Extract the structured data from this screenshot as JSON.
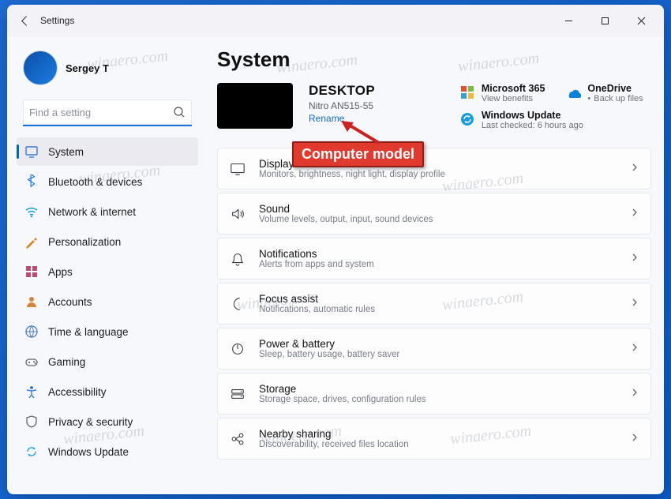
{
  "app": {
    "title": "Settings"
  },
  "user": {
    "name": "Sergey T"
  },
  "search": {
    "placeholder": "Find a setting"
  },
  "nav": {
    "items": [
      {
        "id": "system",
        "icon": "monitor",
        "label": "System",
        "active": true,
        "color": "#3a7bd5"
      },
      {
        "id": "bluetooth",
        "icon": "bluetooth",
        "label": "Bluetooth & devices",
        "color": "#1a73d9"
      },
      {
        "id": "network",
        "icon": "wifi",
        "label": "Network & internet",
        "color": "#18a0d8"
      },
      {
        "id": "personalization",
        "icon": "brush",
        "label": "Personalization",
        "color": "#d88a2a"
      },
      {
        "id": "apps",
        "icon": "grid",
        "label": "Apps",
        "color": "#c24a6e"
      },
      {
        "id": "accounts",
        "icon": "person",
        "label": "Accounts",
        "color": "#d8843a"
      },
      {
        "id": "time",
        "icon": "globe",
        "label": "Time & language",
        "color": "#4a7ac2"
      },
      {
        "id": "gaming",
        "icon": "gamepad",
        "label": "Gaming",
        "color": "#666"
      },
      {
        "id": "accessibility",
        "icon": "accessibility",
        "label": "Accessibility",
        "color": "#3a7bd5"
      },
      {
        "id": "privacy",
        "icon": "shield",
        "label": "Privacy & security",
        "color": "#666"
      },
      {
        "id": "update",
        "icon": "sync",
        "label": "Windows Update",
        "color": "#1a9de0"
      }
    ]
  },
  "page": {
    "title": "System"
  },
  "device": {
    "name": "DESKTOP",
    "model": "Nitro AN515-55",
    "rename_label": "Rename"
  },
  "tiles": {
    "m365": {
      "title": "Microsoft 365",
      "sub": "View benefits"
    },
    "onedrive": {
      "title": "OneDrive",
      "sub": "Back up files"
    },
    "update": {
      "title": "Windows Update",
      "sub": "Last checked: 6 hours ago"
    }
  },
  "cards": [
    {
      "id": "display",
      "icon": "display",
      "title": "Display",
      "sub": "Monitors, brightness, night light, display profile"
    },
    {
      "id": "sound",
      "icon": "sound",
      "title": "Sound",
      "sub": "Volume levels, output, input, sound devices"
    },
    {
      "id": "notifications",
      "icon": "bell",
      "title": "Notifications",
      "sub": "Alerts from apps and system"
    },
    {
      "id": "focus",
      "icon": "moon",
      "title": "Focus assist",
      "sub": "Notifications, automatic rules"
    },
    {
      "id": "power",
      "icon": "power",
      "title": "Power & battery",
      "sub": "Sleep, battery usage, battery saver"
    },
    {
      "id": "storage",
      "icon": "storage",
      "title": "Storage",
      "sub": "Storage space, drives, configuration rules"
    },
    {
      "id": "nearby",
      "icon": "share",
      "title": "Nearby sharing",
      "sub": "Discoverability, received files location"
    }
  ],
  "annotation": {
    "label": "Computer model"
  },
  "watermark": "winaero.com"
}
